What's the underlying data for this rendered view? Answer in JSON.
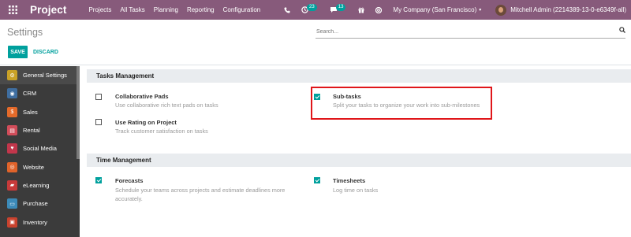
{
  "navbar": {
    "app_name": "Project",
    "menu": [
      "Projects",
      "All Tasks",
      "Planning",
      "Reporting",
      "Configuration"
    ],
    "activity_count": "23",
    "messages_count": "13",
    "company": "My Company (San Francisco)",
    "user": "Mitchell Admin (2214389-13-0-e6349f-all)"
  },
  "control_panel": {
    "title": "Settings",
    "search_placeholder": "Search...",
    "save_label": "SAVE",
    "discard_label": "DISCARD"
  },
  "sidebar": {
    "items": [
      {
        "label": "General Settings",
        "icon": "gear-icon",
        "color": "#c9a227"
      },
      {
        "label": "CRM",
        "icon": "crm-icon",
        "color": "#3f6ea0"
      },
      {
        "label": "Sales",
        "icon": "sales-icon",
        "color": "#e46a2a"
      },
      {
        "label": "Rental",
        "icon": "rental-icon",
        "color": "#d24d5a"
      },
      {
        "label": "Social Media",
        "icon": "social-icon",
        "color": "#c2364b"
      },
      {
        "label": "Website",
        "icon": "website-icon",
        "color": "#e0632a"
      },
      {
        "label": "eLearning",
        "icon": "elearning-icon",
        "color": "#c83a3a"
      },
      {
        "label": "Purchase",
        "icon": "purchase-icon",
        "color": "#3c8ab8"
      },
      {
        "label": "Inventory",
        "icon": "inventory-icon",
        "color": "#c8422e"
      }
    ]
  },
  "sections": {
    "tasks": {
      "title": "Tasks Management",
      "collab_title": "Collaborative Pads",
      "collab_desc": "Use collaborative rich text pads on tasks",
      "rating_title": "Use Rating on Project",
      "rating_desc": "Track customer satisfaction on tasks",
      "subtasks_title": "Sub-tasks",
      "subtasks_desc": "Split your tasks to organize your work into sub-milestones"
    },
    "time": {
      "title": "Time Management",
      "forecasts_title": "Forecasts",
      "forecasts_desc": "Schedule your teams across projects and estimate deadlines more accurately.",
      "timesheets_title": "Timesheets",
      "timesheets_desc": "Log time on tasks"
    }
  },
  "colors": {
    "navbar": "#875a7b",
    "accent": "#00a09d",
    "highlight": "#e0161a"
  }
}
